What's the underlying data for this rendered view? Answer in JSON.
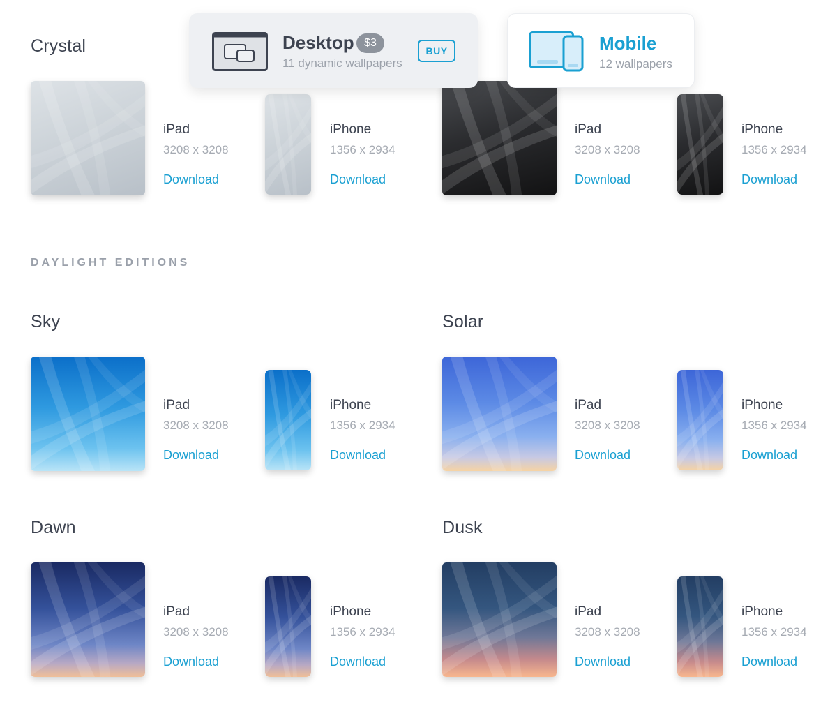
{
  "desktop_card": {
    "title": "Desktop",
    "price": "$3",
    "subtitle": "11 dynamic wallpapers",
    "buy_label": "BUY"
  },
  "mobile_card": {
    "title": "Mobile",
    "subtitle": "12 wallpapers"
  },
  "section_label": "DAYLIGHT EDITIONS",
  "download_label": "Download",
  "groups": [
    {
      "title": "Crystal",
      "ipad": {
        "device": "iPad",
        "resolution": "3208 x 3208"
      },
      "iphone": {
        "device": "iPhone",
        "resolution": "1356 x 2934"
      }
    },
    {
      "title": "",
      "ipad": {
        "device": "iPad",
        "resolution": "3208 x 3208"
      },
      "iphone": {
        "device": "iPhone",
        "resolution": "1356 x 2934"
      }
    },
    {
      "title": "Sky",
      "ipad": {
        "device": "iPad",
        "resolution": "3208 x 3208"
      },
      "iphone": {
        "device": "iPhone",
        "resolution": "1356 x 2934"
      }
    },
    {
      "title": "Solar",
      "ipad": {
        "device": "iPad",
        "resolution": "3208 x 3208"
      },
      "iphone": {
        "device": "iPhone",
        "resolution": "1356 x 2934"
      }
    },
    {
      "title": "Dawn",
      "ipad": {
        "device": "iPad",
        "resolution": "3208 x 3208"
      },
      "iphone": {
        "device": "iPhone",
        "resolution": "1356 x 2934"
      }
    },
    {
      "title": "Dusk",
      "ipad": {
        "device": "iPad",
        "resolution": "3208 x 3208"
      },
      "iphone": {
        "device": "iPhone",
        "resolution": "1356 x 2934"
      }
    }
  ],
  "colors": {
    "accent": "#1aa0d2",
    "heading": "#3d4350",
    "muted": "#a6abb3"
  }
}
